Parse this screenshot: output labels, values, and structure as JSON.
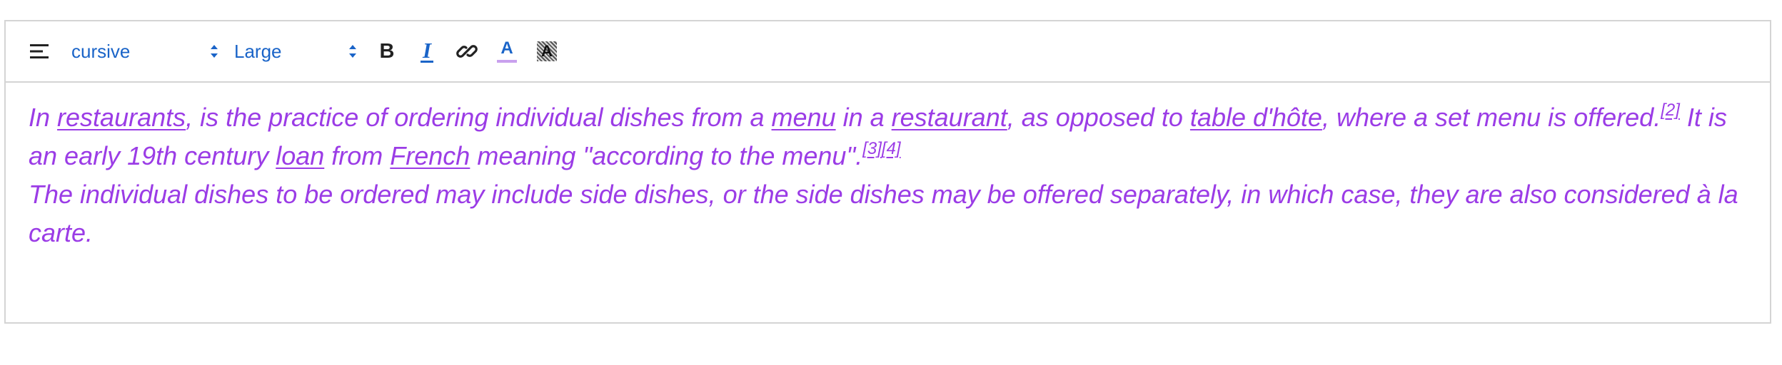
{
  "toolbar": {
    "align_icon": "align-left-icon",
    "font_family": "cursive",
    "font_size": "Large",
    "bold_label": "B",
    "italic_label": "I",
    "link_icon": "link-icon",
    "font_color_label": "A",
    "font_color_icon": "text-color-icon",
    "highlight_label": "A",
    "highlight_icon": "background-color-icon",
    "accent_color": "#1a64c8",
    "font_color_bar": "#c9a0ee"
  },
  "content": {
    "text_color": "#9b3ce6",
    "p1": {
      "t1": "In ",
      "link_restaurants": "restaurants",
      "t2": ",  is the practice of ordering individual dishes from a ",
      "link_menu": "menu",
      "t3": " in a ",
      "link_restaurant": "restaurant",
      "t4": ", as opposed to ",
      "link_table": "table d'hôte",
      "t5": ", where a set menu is offered.",
      "ref2": "[2]",
      "t6": " It is an early 19th century ",
      "link_loan": "loan",
      "t7": " from ",
      "link_french": "French",
      "t8": " meaning \"according to the menu\".",
      "ref3": "[3]",
      "ref4": "[4]"
    },
    "p2": "The individual dishes to be ordered may include side dishes, or the side dishes may be offered separately, in which case, they are also considered à la carte."
  }
}
